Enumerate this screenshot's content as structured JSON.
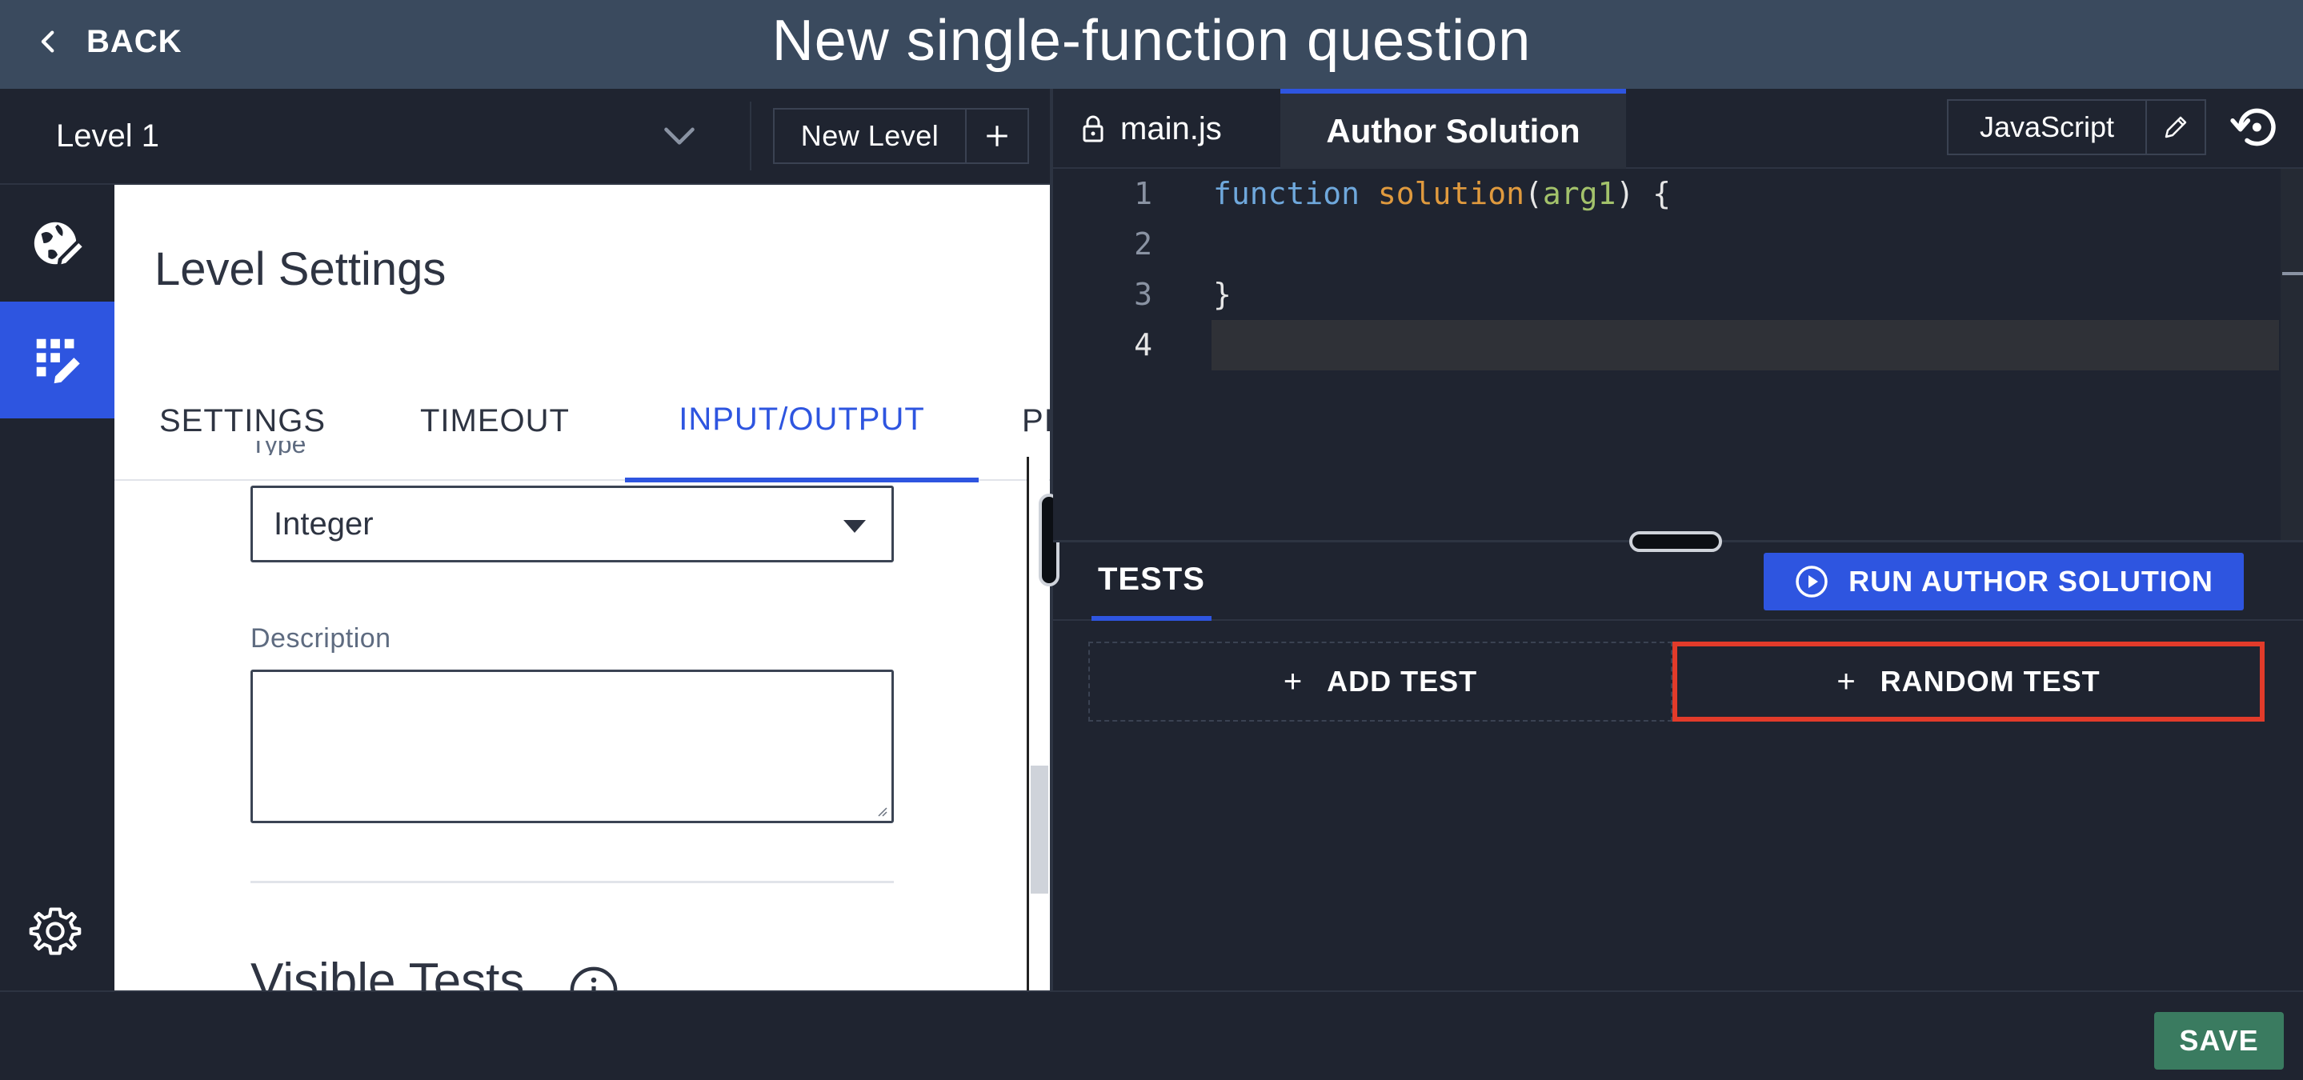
{
  "header": {
    "back_label": "BACK",
    "title": "New single-function question"
  },
  "level_bar": {
    "selected_level": "Level 1",
    "new_level_label": "New Level"
  },
  "settings_panel": {
    "title": "Level Settings",
    "tabs": [
      {
        "label": "SETTINGS",
        "active": false
      },
      {
        "label": "TIMEOUT",
        "active": false
      },
      {
        "label": "INPUT/OUTPUT",
        "active": true
      },
      {
        "label": "PI",
        "active": false
      }
    ],
    "type_label": "Type",
    "type_value": "Integer",
    "description_label": "Description",
    "description_value": "",
    "visible_tests_heading": "Visible Tests"
  },
  "editor": {
    "file_tab": "main.js",
    "active_tab": "Author Solution",
    "language": "JavaScript",
    "line_numbers": [
      "1",
      "2",
      "3",
      "4"
    ],
    "code": {
      "keyword": "function",
      "function_name": "solution",
      "open_paren": "(",
      "argument": "arg1",
      "close_paren_brace": ") {",
      "closing_brace": "}"
    }
  },
  "tests": {
    "tab_label": "TESTS",
    "run_button": "RUN AUTHOR SOLUTION",
    "add_test": "ADD TEST",
    "random_test": "RANDOM TEST",
    "plus": "+"
  },
  "footer": {
    "save_label": "SAVE"
  },
  "colors": {
    "header_bg": "#3a4a5e",
    "app_bg": "#1f2430",
    "accent_blue": "#2e55e0",
    "save_green": "#3a7b60",
    "highlight_red": "#e23b2a"
  }
}
